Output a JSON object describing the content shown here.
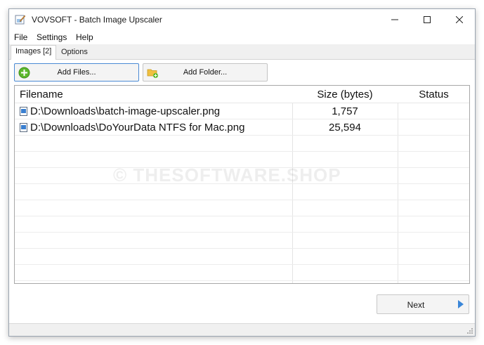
{
  "window": {
    "title": "VOVSOFT - Batch Image Upscaler",
    "icons": {
      "app": "app-edit-icon",
      "minimize": "minimize-icon",
      "maximize": "maximize-icon",
      "close": "close-icon"
    }
  },
  "menu": {
    "items": [
      "File",
      "Settings",
      "Help"
    ]
  },
  "tabs": [
    {
      "label": "Images [2]",
      "active": true
    },
    {
      "label": "Options",
      "active": false
    }
  ],
  "toolbar": {
    "add_files_label": "Add Files...",
    "add_files_icon": "add-circle-icon",
    "add_folder_label": "Add Folder...",
    "add_folder_icon": "folder-add-icon"
  },
  "grid": {
    "columns": [
      "Filename",
      "Size (bytes)",
      "Status"
    ],
    "rows": [
      {
        "filename": "D:\\Downloads\\batch-image-upscaler.png",
        "size": "1,757",
        "status": ""
      },
      {
        "filename": "D:\\Downloads\\DoYourData NTFS for Mac.png",
        "size": "25,594",
        "status": ""
      }
    ]
  },
  "watermark": "© THESOFTWARE.SHOP",
  "next_button": {
    "label": "Next",
    "icon": "arrow-right-icon"
  },
  "colors": {
    "accent": "#4a8ad4",
    "add_icon_green": "#5cb82c",
    "folder_yellow": "#f0c040"
  }
}
